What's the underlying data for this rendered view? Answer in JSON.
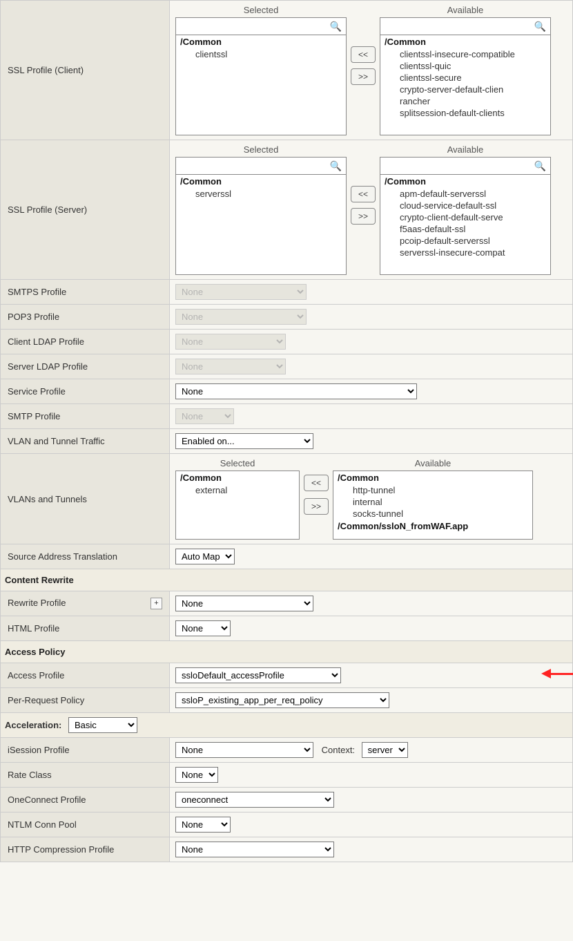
{
  "dual": {
    "selected_label": "Selected",
    "available_label": "Available",
    "move_left": "<<",
    "move_right": ">>"
  },
  "ssl_client": {
    "label": "SSL Profile (Client)",
    "selected_group": "/Common",
    "selected_items": [
      "clientssl"
    ],
    "available_group": "/Common",
    "available_items": [
      "clientssl-insecure-compatible",
      "clientssl-quic",
      "clientssl-secure",
      "crypto-server-default-clien",
      "rancher",
      "splitsession-default-clients"
    ]
  },
  "ssl_server": {
    "label": "SSL Profile (Server)",
    "selected_group": "/Common",
    "selected_items": [
      "serverssl"
    ],
    "available_group": "/Common",
    "available_items": [
      "apm-default-serverssl",
      "cloud-service-default-ssl",
      "crypto-client-default-serve",
      "f5aas-default-ssl",
      "pcoip-default-serverssl",
      "serverssl-insecure-compat"
    ]
  },
  "smtps": {
    "label": "SMTPS Profile",
    "value": "None"
  },
  "pop3": {
    "label": "POP3 Profile",
    "value": "None"
  },
  "client_ldap": {
    "label": "Client LDAP Profile",
    "value": "None"
  },
  "server_ldap": {
    "label": "Server LDAP Profile",
    "value": "None"
  },
  "service": {
    "label": "Service Profile",
    "value": "None"
  },
  "smtp": {
    "label": "SMTP Profile",
    "value": "None"
  },
  "vlan_traffic": {
    "label": "VLAN and Tunnel Traffic",
    "value": "Enabled on..."
  },
  "vlans_tunnels": {
    "label": "VLANs and Tunnels",
    "selected_group": "/Common",
    "selected_items": [
      "external"
    ],
    "available_group": "/Common",
    "available_items": [
      "http-tunnel",
      "internal",
      "socks-tunnel"
    ],
    "available_group2": "/Common/ssloN_fromWAF.app"
  },
  "snat": {
    "label": "Source Address Translation",
    "value": "Auto Map"
  },
  "content_rewrite_header": "Content Rewrite",
  "rewrite_profile": {
    "label": "Rewrite Profile",
    "value": "None",
    "plus": "+"
  },
  "html_profile": {
    "label": "HTML Profile",
    "value": "None"
  },
  "access_policy_header": "Access Policy",
  "access_profile": {
    "label": "Access Profile",
    "value": "ssloDefault_accessProfile"
  },
  "per_request": {
    "label": "Per-Request Policy",
    "value": "ssloP_existing_app_per_req_policy"
  },
  "acceleration": {
    "label": "Acceleration:",
    "value": "Basic"
  },
  "isession": {
    "label": "iSession Profile",
    "value": "None",
    "context_label": "Context:",
    "context_value": "server"
  },
  "rate_class": {
    "label": "Rate Class",
    "value": "None"
  },
  "oneconnect": {
    "label": "OneConnect Profile",
    "value": "oneconnect"
  },
  "ntlm": {
    "label": "NTLM Conn Pool",
    "value": "None"
  },
  "http_compress": {
    "label": "HTTP Compression Profile",
    "value": "None"
  }
}
